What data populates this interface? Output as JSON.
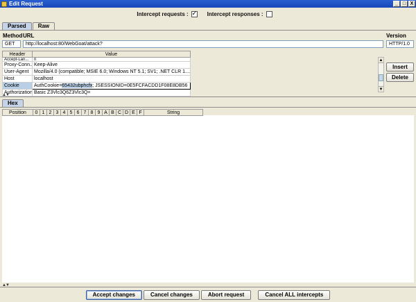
{
  "window": {
    "title": "Edit Request"
  },
  "window_controls": [
    "_",
    "□",
    "X"
  ],
  "intercept": {
    "requests_label": "Intercept requests :",
    "requests_checked": true,
    "responses_label": "Intercept responses :",
    "responses_checked": false
  },
  "top_tabs": [
    {
      "label": "Parsed",
      "active": true
    },
    {
      "label": "Raw",
      "active": false
    }
  ],
  "request_line": {
    "method_label": "Method",
    "url_label": "URL",
    "version_label": "Version",
    "method": "GET",
    "url": "http://localhost:80/WebGoat/attack?",
    "version": "HTTP/1.0"
  },
  "headers_table": {
    "columns": [
      "Header",
      "Value"
    ],
    "rows": [
      {
        "header": "Accept-Lan...",
        "value": "ri"
      },
      {
        "header": "Proxy-Conn...",
        "value": "Keep-Alive"
      },
      {
        "header": "User-Agent",
        "value": "Mozilla/4.0 (compatible; MSIE 6.0; Windows NT 5.1; SV1; .NET CLR 1...."
      },
      {
        "header": "Host",
        "value": "localhost"
      },
      {
        "header": "Cookie",
        "value_prefix": "AuthCookie=",
        "value_highlight": "65432ubphcfx",
        "value_suffix": "; JSESSIONID=0E5FCFACDD1F08E8DB56",
        "selected": true
      },
      {
        "header": "Authorization",
        "value": "Basic Z3Vlc3Q6Z3Vlc3Q="
      }
    ]
  },
  "side_buttons": {
    "insert": "Insert",
    "delete": "Delete"
  },
  "hex_tab": {
    "label": "Hex"
  },
  "hex_table": {
    "columns": [
      "Position",
      "0",
      "1",
      "2",
      "3",
      "4",
      "5",
      "6",
      "7",
      "8",
      "9",
      "A",
      "B",
      "C",
      "D",
      "E",
      "F",
      "String"
    ]
  },
  "bottom_buttons": {
    "accept": "Accept changes",
    "cancel": "Cancel changes",
    "abort": "Abort request",
    "cancel_all": "Cancel ALL intercepts"
  }
}
